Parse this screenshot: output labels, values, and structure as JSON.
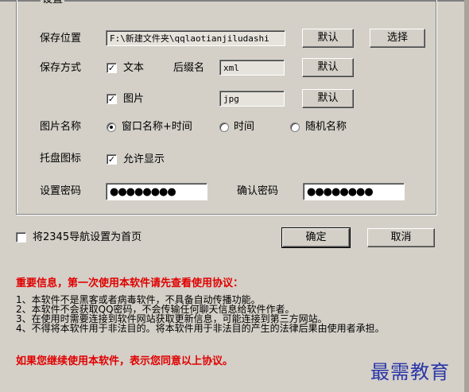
{
  "group": {
    "title": "设置"
  },
  "save_location": {
    "label": "保存位置",
    "path": "F:\\新建文件夹\\qqlaotianjiludashi",
    "default_button": "默认",
    "choose_button": "选择"
  },
  "save_method": {
    "label": "保存方式",
    "text_option": {
      "checked": true,
      "label": "文本",
      "suffix_label": "后缀名",
      "suffix": "xml",
      "default_button": "默认"
    },
    "image_option": {
      "checked": true,
      "label": "图片",
      "suffix": "jpg",
      "default_button": "默认"
    }
  },
  "image_name": {
    "label": "图片名称",
    "options": [
      {
        "label": "窗口名称+时间",
        "selected": true
      },
      {
        "label": "时间",
        "selected": false
      },
      {
        "label": "随机名称",
        "selected": false
      }
    ]
  },
  "tray_icon": {
    "label": "托盘图标",
    "checked": true,
    "option_label": "允许显示"
  },
  "password": {
    "label": "设置密码",
    "value": "●●●●●●●●",
    "confirm_label": "确认密码",
    "confirm_value": "●●●●●●●●"
  },
  "homepage": {
    "checked": false,
    "label": "将2345导航设置为首页"
  },
  "buttons": {
    "ok": "确定",
    "cancel": "取消"
  },
  "notice": {
    "heading": "重要信息，第一次使用本软件请先查看使用协议：",
    "terms": [
      "1、本软件不是黑客或者病毒软件，不具备自动传播功能。",
      "2、本软件不会获取QQ密码，不会传输任何聊天信息给软件作者。",
      "3、在使用时需要连接到软件网站获取更新信息，可能连接到第三方网站。",
      "4、不得将本软件用于非法目的。将本软件用于非法目的产生的法律后果由使用者承担。"
    ],
    "footer": "如果您继续使用本软件，表示您同意以上协议。"
  },
  "watermark": "最需教育"
}
